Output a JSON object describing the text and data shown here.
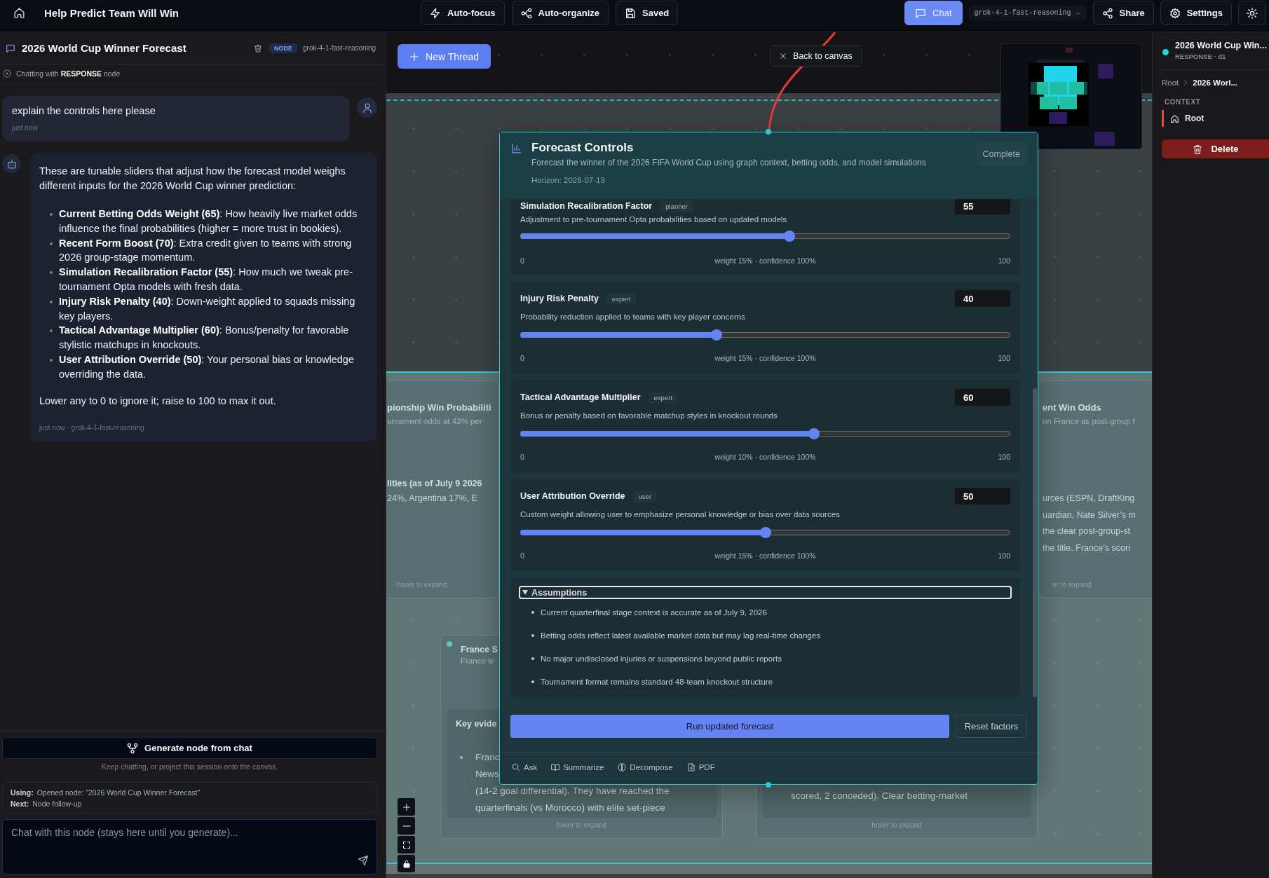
{
  "top_bar": {
    "title": "Help Predict Team Will Win",
    "tools": [
      {
        "label": "Auto-focus",
        "kind": "focus"
      },
      {
        "label": "Auto-organize",
        "kind": "organize"
      },
      {
        "label": "Saved",
        "kind": "save"
      }
    ],
    "chat_button": {
      "label": "Chat",
      "selected": true
    },
    "model_select": {
      "value": "grok-4-1-fast-reasoning"
    },
    "actions": [
      {
        "label": "Share",
        "kind": "share"
      },
      {
        "label": "Settings",
        "kind": "settings"
      }
    ]
  },
  "chat_panel": {
    "title": "2026 World Cup Winner Forecast",
    "badge": "NODE",
    "model": "grok-4-1-fast-reasoning",
    "status": "Chatting with **RESPONSE** node",
    "messages": [
      {
        "kind": "question",
        "text": "explain the controls here please",
        "meta": "just now"
      },
      {
        "kind": "answer",
        "intro": "These are tunable sliders that adjust how the forecast model weighs different inputs for the 2026 World Cup winner prediction:",
        "bullets": [
          "**Current Betting Odds Weight (65)**: How heavily live market odds influence the final probabilities (higher = more trust in bookies).",
          "**Recent Form Boost (70)**: Extra credit given to teams with strong 2026 group-stage momentum.",
          "**Simulation Recalibration Factor (55)**: How much we tweak pre-tournament Opta models with fresh data.",
          "**Injury Risk Penalty (40)**: Down-weight applied to squads missing key players.",
          "**Tactical Advantage Multiplier (60)**: Bonus/penalty for favorable stylistic matchups in knockouts.",
          "**User Attribution Override (50)**: Your personal bias or knowledge overriding the data."
        ],
        "outro": "Lower any to 0 to ignore it; raise to 100 to max it out.",
        "meta": "just now · grok-4-1-fast-reasoning"
      }
    ],
    "generate_button": "Generate node from chat",
    "hint": "Keep chatting, or project this session onto the canvas.",
    "context": [
      {
        "label": "Using:",
        "value": "Opened node: \"2026 World Cup Winner Forecast\""
      },
      {
        "label": "Next:",
        "value": "Node follow-up"
      }
    ],
    "input": {
      "placeholder": "Chat with this node (stays here until you generate)..."
    }
  },
  "canvas": {
    "new_thread_button": "New Thread",
    "back_button": "Back to canvas",
    "nodes": [
      {
        "kind": "summary",
        "title": "pionship Win Probabiliti",
        "subtitle": "urnament odds at 43% per",
        "heading": "lities (as of July 9 2026",
        "lines": [
          "24%, Argentina 17%, E"
        ],
        "footer": "hover to expand"
      },
      {
        "kind": "summary",
        "title": "ent Win Odds",
        "subtitle": "on France as post-group f",
        "lines": [
          "urces (ESPN, DraftKing",
          "uardian, Nate Silver’s m",
          "the clear post-group-st",
          "the title. France’s scori"
        ],
        "footer": "er to expand"
      },
      {
        "kind": "evidence",
        "title": "France S",
        "subtitle": "France le",
        "heading": "Key evide",
        "items": [
          {
            "text": "Franc",
            "bullet": true
          },
          {
            "text": "News",
            "bullet": false
          },
          {
            "text": "(14-2 goal differential). They have reached the",
            "bullet": false
          },
          {
            "text": "quarterfinals (vs Morocco) with elite set-piece",
            "bullet": false
          }
        ],
        "footer": "hover to expand"
      },
      {
        "kind": "evidence",
        "items": [
          {
            "text": "scored, 2 conceded). Clear betting-market",
            "bullet": false
          }
        ],
        "footer": "hover to expand"
      }
    ]
  },
  "forecast_modal": {
    "title": "Forecast Controls",
    "description": "Forecast the winner of the 2026 FIFA World Cup using graph context, betting odds, and model simulations",
    "horizon": "Horizon: 2026-07-19",
    "status": "Complete",
    "factors": [
      {
        "name": "Simulation Recalibration Factor",
        "tag": "planner",
        "value": "55",
        "description": "Adjustment to pre-tournament Opta probabilities based on updated models",
        "level": 0.55,
        "min": "0",
        "max": "100",
        "stats": "weight 15% · confidence 100%"
      },
      {
        "name": "Injury Risk Penalty",
        "tag": "expert",
        "value": "40",
        "description": "Probability reduction applied to teams with key player concerns",
        "level": 0.4,
        "min": "0",
        "max": "100",
        "stats": "weight 15% · confidence 100%"
      },
      {
        "name": "Tactical Advantage Multiplier",
        "tag": "expert",
        "value": "60",
        "description": "Bonus or penalty based on favorable matchup styles in knockout rounds",
        "level": 0.6,
        "min": "0",
        "max": "100",
        "stats": "weight 10% · confidence 100%"
      },
      {
        "name": "User Attribution Override",
        "tag": "user",
        "value": "50",
        "description": "Custom weight allowing user to emphasize personal knowledge or bias over data sources",
        "level": 0.5,
        "min": "0",
        "max": "100",
        "stats": "weight 15% · confidence 100%"
      }
    ],
    "assumptions": {
      "title": "Assumptions",
      "expanded": true,
      "items": [
        "Current quarterfinal stage context is accurate as of July 9, 2026",
        "Betting odds reflect latest available market data but may lag real-time changes",
        "No major undisclosed injuries or suspensions beyond public reports",
        "Tournament format remains standard 48-team knockout structure"
      ]
    },
    "run_button": "Run updated forecast",
    "reset_button": "Reset factors",
    "tools": [
      {
        "label": "Ask",
        "kind": "ask"
      },
      {
        "label": "Summarize",
        "kind": "summarize"
      },
      {
        "label": "Decompose",
        "kind": "decompose"
      },
      {
        "label": "PDF",
        "kind": "pdf"
      }
    ]
  },
  "inspector": {
    "node_title": "2026 World Cup Win...",
    "node_meta": "RESPONSE · d1",
    "breadcrumb": [
      "Root",
      "2026 Worl..."
    ],
    "context_label": "CONTEXT",
    "context_items": [
      {
        "label": "Root",
        "selected": true
      }
    ],
    "delete_button": "Delete"
  }
}
